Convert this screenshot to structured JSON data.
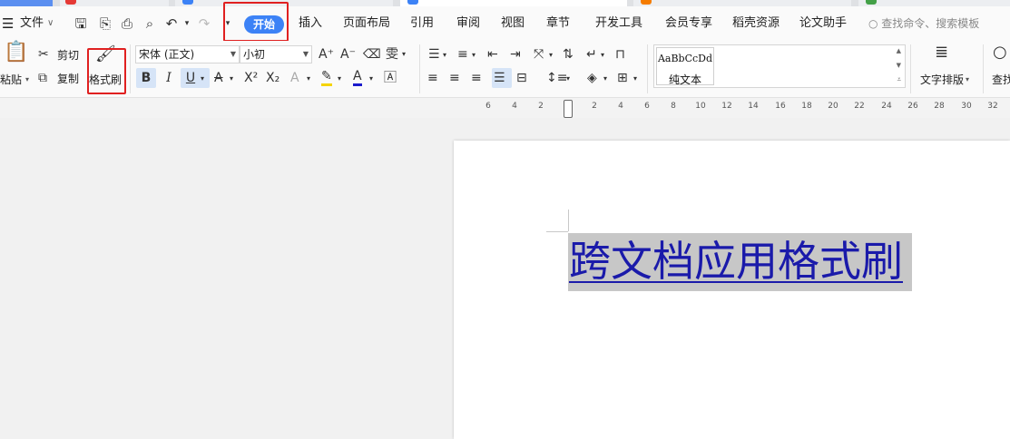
{
  "menu": {
    "file": "文件",
    "tabs": [
      "开始",
      "插入",
      "页面布局",
      "引用",
      "审阅",
      "视图",
      "章节",
      "开发工具",
      "会员专享",
      "稻壳资源",
      "论文助手"
    ],
    "active_tab": "开始",
    "search_placeholder": "查找命令、搜索模板"
  },
  "ribbon": {
    "paste": "粘贴",
    "cut": "剪切",
    "copy": "复制",
    "format_painter": "格式刷",
    "font_name": "宋体 (正文)",
    "font_size": "小初",
    "bold": "B",
    "italic": "I",
    "underline": "U",
    "style_sample": "AaBbCcDd",
    "style_name": "纯文本",
    "text_layout": "文字排版",
    "find": "查找"
  },
  "ruler": {
    "labels": [
      "6",
      "4",
      "2",
      "2",
      "4",
      "6",
      "8",
      "10",
      "12",
      "14",
      "16",
      "18",
      "20",
      "22",
      "24",
      "26",
      "28",
      "30",
      "32"
    ]
  },
  "document": {
    "heading": "跨文档应用格式刷"
  },
  "colors": {
    "accent": "#3c82f6",
    "highlight_box": "#e02020",
    "selection": "#c7c7c7",
    "link_text": "#1a1aaa"
  }
}
